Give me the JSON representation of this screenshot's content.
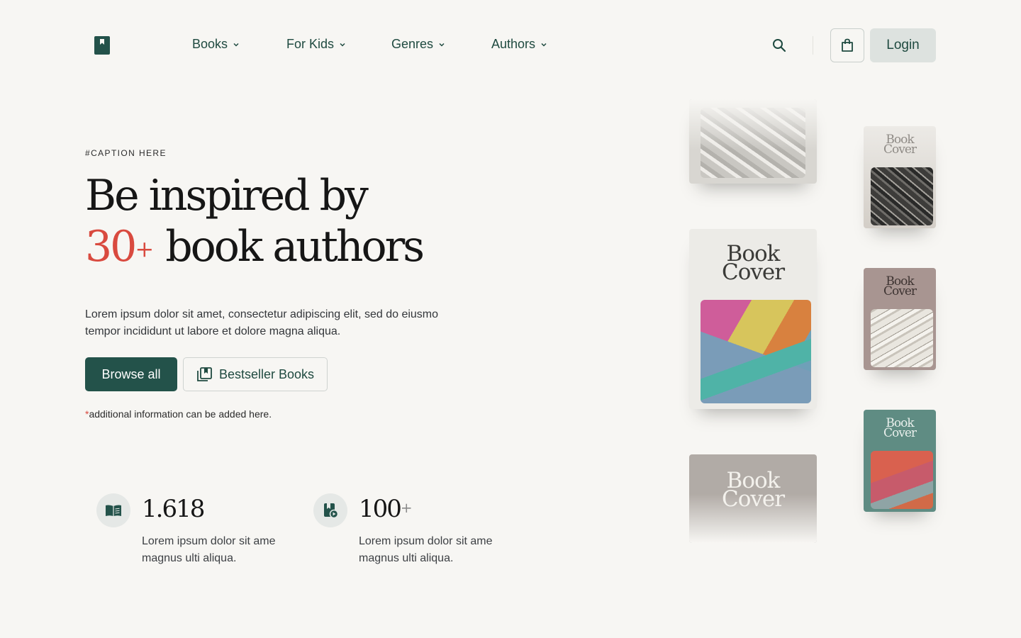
{
  "header": {
    "nav": [
      {
        "label": "Books"
      },
      {
        "label": "For Kids"
      },
      {
        "label": "Genres"
      },
      {
        "label": "Authors"
      }
    ],
    "login_label": "Login"
  },
  "hero": {
    "caption": "#CAPTION HERE",
    "headline_line1": "Be inspired by",
    "headline_number": "30",
    "headline_plus": "+",
    "headline_rest": " book authors",
    "description": "Lorem ipsum dolor sit amet, consectetur adipiscing elit, sed do eiusmo tempor incididunt ut labore et dolore magna aliqua.",
    "primary_button": "Browse all",
    "secondary_button": "Bestseller Books",
    "note_star": "*",
    "note": "additional information can be added here."
  },
  "stats": [
    {
      "value": "1.618",
      "plus": "",
      "description": "Lorem ipsum dolor sit ame magnus ulti aliqua.",
      "icon": "open-book-icon"
    },
    {
      "value": "100",
      "plus": "+",
      "description": "Lorem ipsum dolor sit ame magnus ulti aliqua.",
      "icon": "book-play-icon"
    }
  ],
  "books": {
    "title_line1": "Book",
    "title_line2": "Cover"
  },
  "colors": {
    "brand": "#23524a",
    "accent": "#d94a3f",
    "background": "#f7f6f3"
  }
}
